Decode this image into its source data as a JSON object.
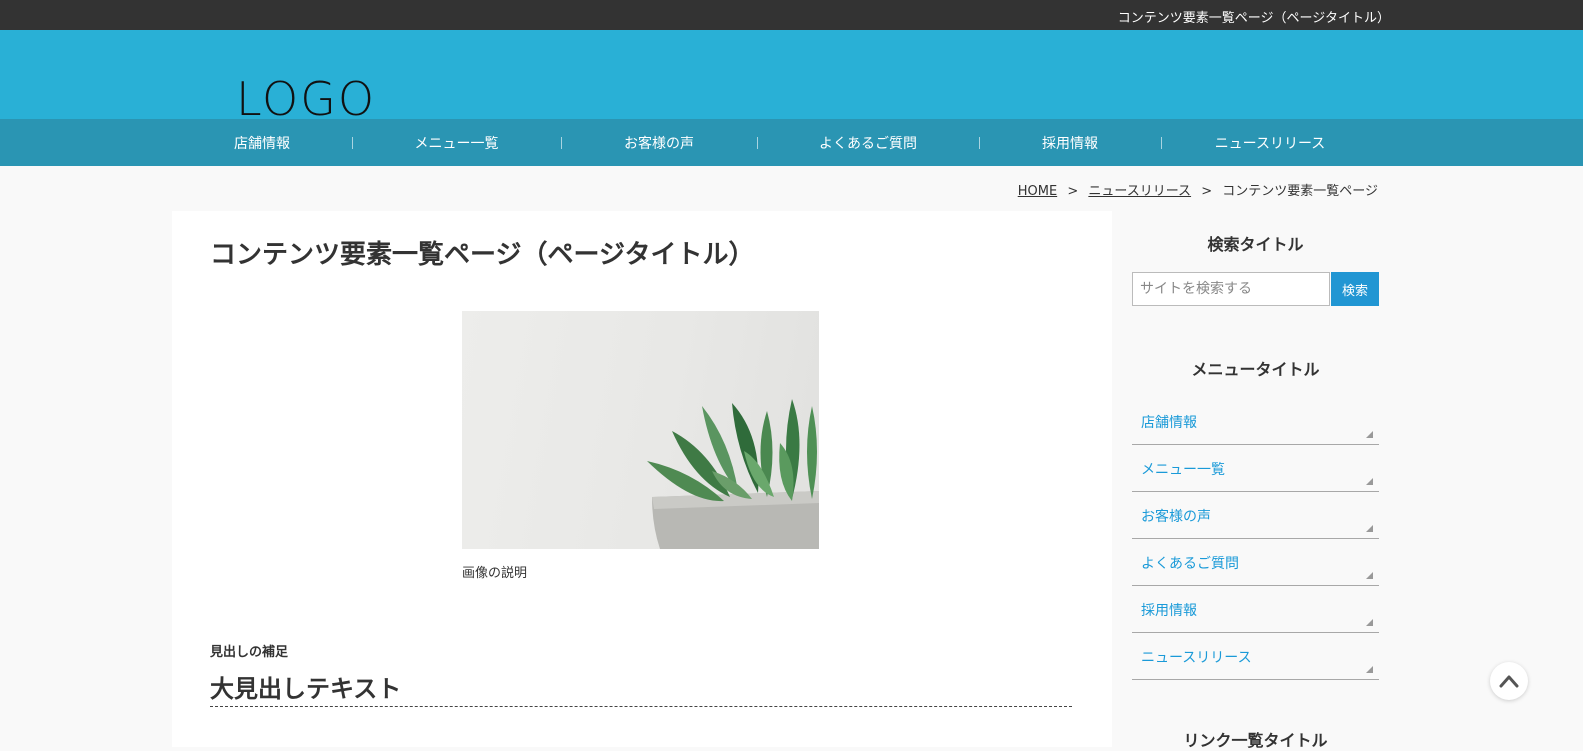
{
  "topbar": {
    "description": "コンテンツ要素一覧ページ（ページタイトル）"
  },
  "header": {
    "logo": "LOGO"
  },
  "global_nav": {
    "items": [
      {
        "label": "店舗情報"
      },
      {
        "label": "メニュー一覧"
      },
      {
        "label": "お客様の声"
      },
      {
        "label": "よくあるご質問"
      },
      {
        "label": "採用情報"
      },
      {
        "label": "ニュースリリース"
      }
    ]
  },
  "breadcrumb": {
    "home": "HOME",
    "separator": ">",
    "parent": "ニュースリリース",
    "current": "コンテンツ要素一覧ページ"
  },
  "main": {
    "title": "コンテンツ要素一覧ページ（ページタイトル）",
    "figure_caption": "画像の説明",
    "heading_sub": "見出しの補足",
    "heading_main": "大見出しテキスト"
  },
  "sidebar": {
    "search_title": "検索タイトル",
    "search_placeholder": "サイトを検索する",
    "search_button": "検索",
    "menu_title": "メニュータイトル",
    "menu_items": [
      {
        "label": "店舗情報"
      },
      {
        "label": "メニュー一覧"
      },
      {
        "label": "お客様の声"
      },
      {
        "label": "よくあるご質問"
      },
      {
        "label": "採用情報"
      },
      {
        "label": "ニュースリリース"
      }
    ],
    "links_title": "リンク一覧タイトル"
  },
  "colors": {
    "topbar": "#333333",
    "header": "#29b0d6",
    "nav": "#2a95b3",
    "link": "#1a9ad8",
    "search_button": "#2196d3"
  }
}
